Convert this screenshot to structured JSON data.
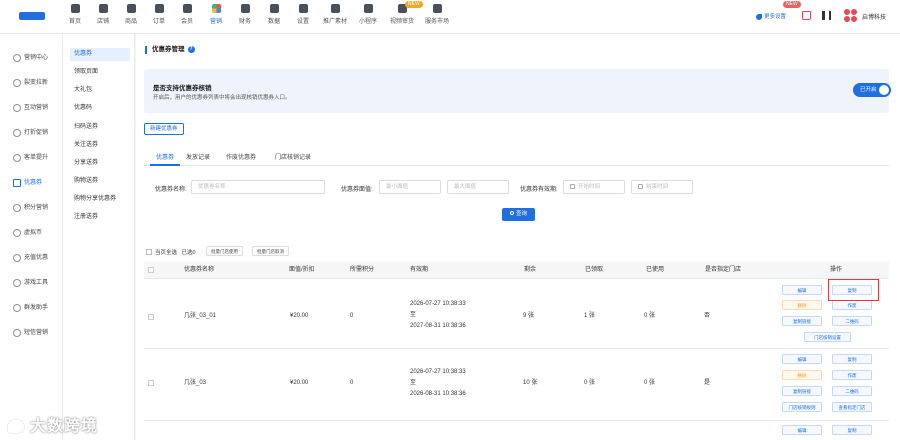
{
  "topnav": [
    {
      "id": "home",
      "label": "首页",
      "icon": "home-icon"
    },
    {
      "id": "store",
      "label": "店铺",
      "icon": "store-icon"
    },
    {
      "id": "goods",
      "label": "商品",
      "icon": "goods-icon"
    },
    {
      "id": "orders",
      "label": "订单",
      "icon": "orders-icon"
    },
    {
      "id": "members",
      "label": "会员",
      "icon": "members-icon"
    },
    {
      "id": "marketing",
      "label": "营销",
      "icon": "marketing-icon",
      "active": true
    },
    {
      "id": "finance",
      "label": "财务",
      "icon": "finance-icon"
    },
    {
      "id": "data",
      "label": "数据",
      "icon": "data-icon"
    },
    {
      "id": "settings",
      "label": "设置",
      "icon": "settings-icon"
    },
    {
      "id": "promo",
      "label": "推广素材",
      "icon": "promo-icon"
    },
    {
      "id": "miniapp",
      "label": "小程序",
      "icon": "miniapp-icon"
    },
    {
      "id": "video",
      "label": "视频审货",
      "icon": "video-icon",
      "badge": "NEW"
    },
    {
      "id": "market",
      "label": "服务市场",
      "icon": "market-icon"
    }
  ],
  "top_right": {
    "more_services": "更多设置",
    "badge": "NEW",
    "shop_name": "启博科技"
  },
  "sidebar_primary": [
    {
      "label": "营销中心"
    },
    {
      "label": "裂变拉新"
    },
    {
      "label": "互动营销"
    },
    {
      "label": "打折促销"
    },
    {
      "label": "客单提升"
    },
    {
      "label": "优惠券",
      "active": true
    },
    {
      "label": "积分营销"
    },
    {
      "label": "虚拟币"
    },
    {
      "label": "充值优惠"
    },
    {
      "label": "游戏工具"
    },
    {
      "label": "群发助手"
    },
    {
      "label": "短信营销"
    }
  ],
  "sidebar_secondary": [
    {
      "label": "优惠券",
      "active": true
    },
    {
      "label": "领取页面"
    },
    {
      "label": "大礼包"
    },
    {
      "label": "优惠码"
    },
    {
      "label": "扫码送券"
    },
    {
      "label": "关注送券"
    },
    {
      "label": "分享送券"
    },
    {
      "label": "购物送券"
    },
    {
      "label": "购物分享优惠券"
    },
    {
      "label": "注册送券"
    }
  ],
  "page": {
    "title": "优惠券管理",
    "notice_title": "是否支持优惠券核销",
    "notice_desc": "开启后，用户的优惠券列表中将会出现核销优惠券入口。",
    "toggle_label": "已开启",
    "toggle_on": true,
    "new_button": "新建优惠券"
  },
  "tabs": [
    "优惠券",
    "发放记录",
    "作废优惠券",
    "门店核销记录"
  ],
  "filters": {
    "name_label": "优惠券名称:",
    "name_placeholder": "优惠券名称",
    "amount_label": "优惠券面值:",
    "min_placeholder": "最小面值",
    "max_placeholder": "最大面值",
    "date_label": "优惠券有效期:",
    "start_placeholder": "开始时间",
    "end_placeholder": "结束时间",
    "search_button": "查询"
  },
  "selection": {
    "label": "当页全选",
    "selected": "已选0",
    "btn1": "批量门店使用",
    "btn2": "批量门店取消"
  },
  "table": {
    "headers": [
      "优惠券名称",
      "面值/折扣",
      "所需积分",
      "有效期",
      "剩余",
      "已领取",
      "已使用",
      "是否指定门店",
      "操作"
    ],
    "rows": [
      {
        "name": "几张_03_01",
        "value": "¥20.00",
        "points": "0",
        "start": "2026-07-27 10:38:33",
        "sep": "至",
        "end": "2027-08-31 10:38:36",
        "remain": "9 张",
        "claimed": "1 张",
        "used": "0 张",
        "store": "否",
        "actions": [
          "编辑",
          "复制",
          "删除",
          "作废",
          "复制链接",
          "二维码",
          "门店核销设置"
        ]
      },
      {
        "name": "几张_03",
        "value": "¥20.00",
        "points": "0",
        "start": "2026-07-27 10:38:33",
        "sep": "至",
        "end": "2026-08-31 10:38:36",
        "remain": "10 张",
        "claimed": "0 张",
        "used": "0 张",
        "store": "是",
        "actions": [
          "编辑",
          "复制",
          "删除",
          "作废",
          "复制链接",
          "二维码",
          "门店核销规则",
          "查看指定门店"
        ]
      },
      {
        "actions": [
          "编辑",
          "复制"
        ]
      }
    ]
  },
  "watermark": "大数跨境"
}
